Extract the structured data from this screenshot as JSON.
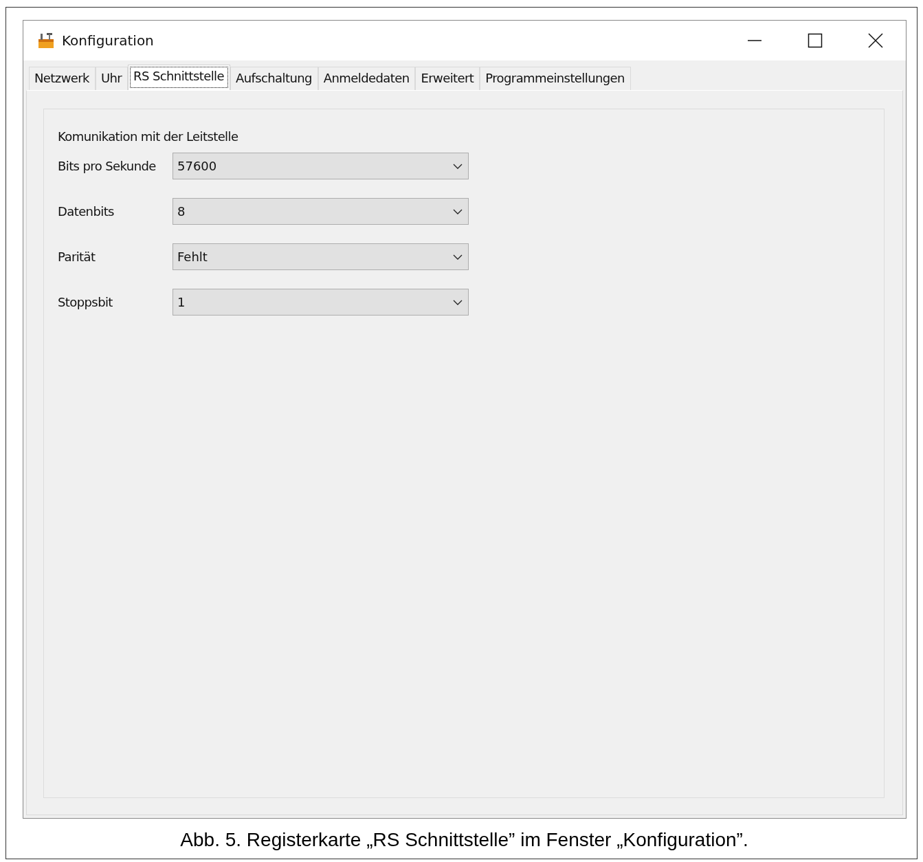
{
  "window": {
    "title": "Konfiguration"
  },
  "tabs": [
    {
      "label": "Netzwerk",
      "selected": false
    },
    {
      "label": "Uhr",
      "selected": false
    },
    {
      "label": "RS Schnittstelle",
      "selected": true
    },
    {
      "label": "Aufschaltung",
      "selected": false
    },
    {
      "label": "Anmeldedaten",
      "selected": false
    },
    {
      "label": "Erweitert",
      "selected": false
    },
    {
      "label": "Programmeinstellungen",
      "selected": false
    }
  ],
  "section": {
    "title": "Komunikation mit der Leitstelle"
  },
  "fields": [
    {
      "label": "Bits pro Sekunde",
      "value": "57600"
    },
    {
      "label": "Datenbits",
      "value": "8"
    },
    {
      "label": "Parität",
      "value": "Fehlt"
    },
    {
      "label": "Stoppsbit",
      "value": "1"
    }
  ],
  "caption": "Abb. 5. Registerkarte „RS Schnittstelle” im Fenster „Konfiguration”."
}
